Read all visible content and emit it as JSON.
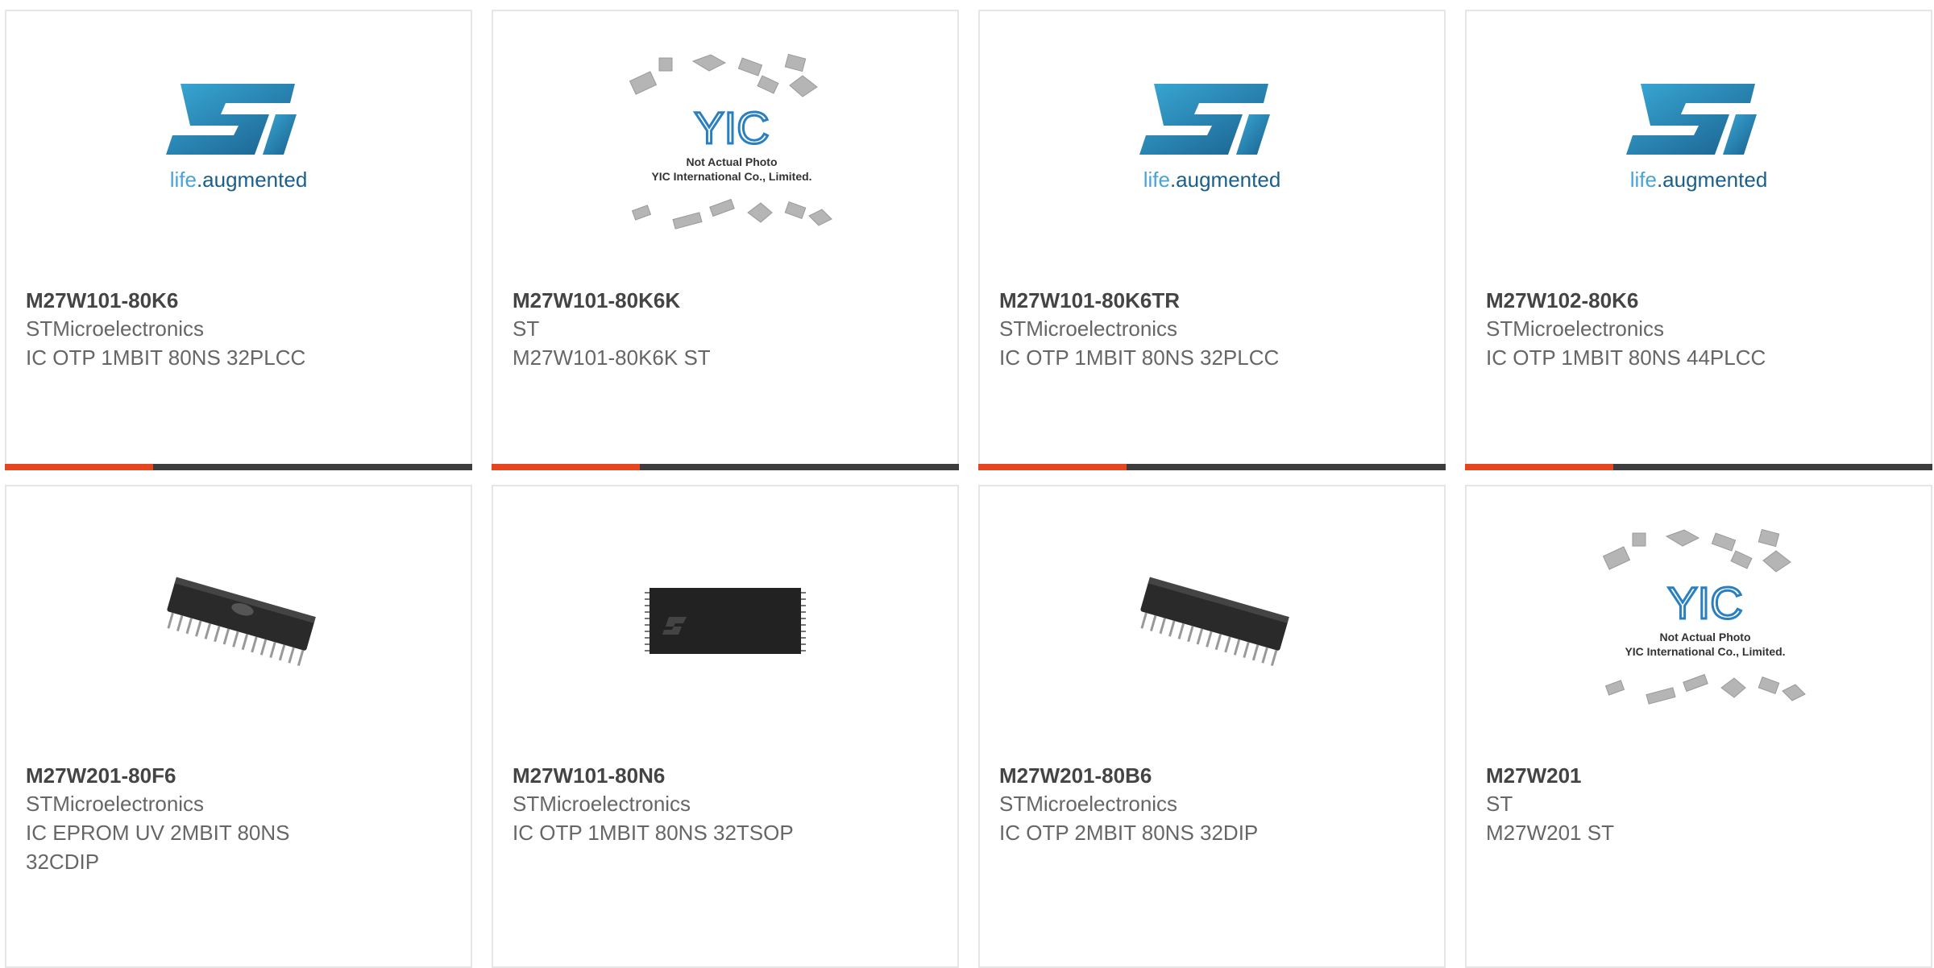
{
  "products": [
    {
      "part": "M27W101-80K6",
      "manufacturer": "STMicroelectronics",
      "description": "IC OTP 1MBIT 80NS 32PLCC",
      "image": "st-logo"
    },
    {
      "part": "M27W101-80K6K",
      "manufacturer": "ST",
      "description": "M27W101-80K6K ST",
      "image": "not-actual-photo"
    },
    {
      "part": "M27W101-80K6TR",
      "manufacturer": "STMicroelectronics",
      "description": "IC OTP 1MBIT 80NS 32PLCC",
      "image": "st-logo"
    },
    {
      "part": "M27W102-80K6",
      "manufacturer": "STMicroelectronics",
      "description": "IC OTP 1MBIT 80NS 44PLCC",
      "image": "st-logo"
    },
    {
      "part": "M27W201-80F6",
      "manufacturer": "STMicroelectronics",
      "description": "IC EPROM UV 2MBIT 80NS 32CDIP",
      "image": "dip-chip-window"
    },
    {
      "part": "M27W101-80N6",
      "manufacturer": "STMicroelectronics",
      "description": "IC OTP 1MBIT 80NS 32TSOP",
      "image": "tsop-chip"
    },
    {
      "part": "M27W201-80B6",
      "manufacturer": "STMicroelectronics",
      "description": "IC OTP 2MBIT 80NS 32DIP",
      "image": "dip-chip"
    },
    {
      "part": "M27W201",
      "manufacturer": "ST",
      "description": "M27W201 ST",
      "image": "not-actual-photo"
    }
  ],
  "placeholder": {
    "brand": "YIC",
    "line1": "Not Actual Photo",
    "line2": "YIC International Co., Limited."
  },
  "st_logo": {
    "tagline_life": "life",
    "tagline_rest": ".augmented"
  },
  "colors": {
    "accent": "#e5461f",
    "bar_dark": "#3d3d3d",
    "st_blue": "#1f7fb5"
  }
}
